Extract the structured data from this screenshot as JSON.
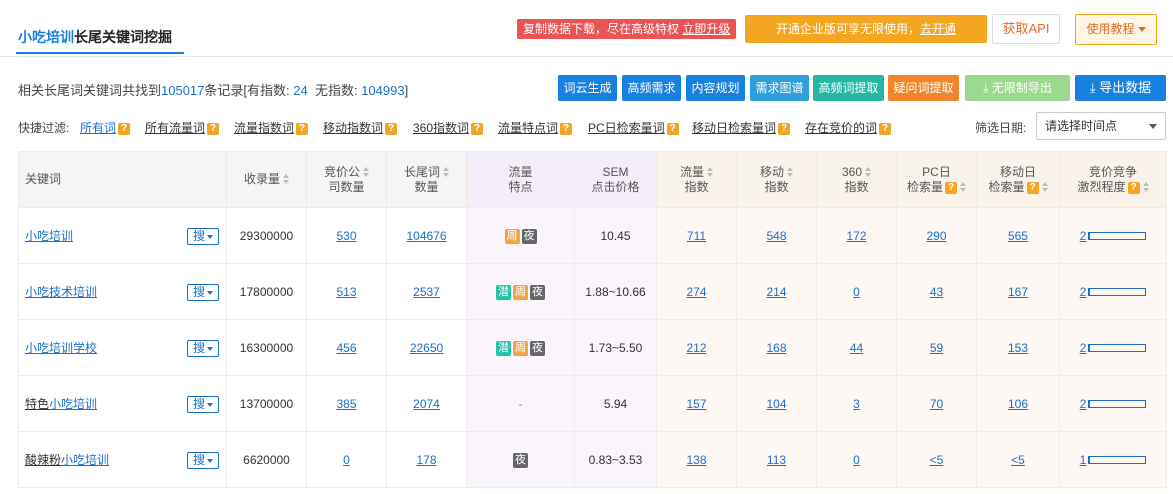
{
  "header": {
    "title_highlight": "小吃培训",
    "title_rest": "长尾关键词挖掘",
    "promo_red_text": "复制数据下载，尽在高级特权",
    "promo_red_link": "立即升级",
    "promo_orange_text": "开通企业版可享无限使用，",
    "promo_orange_link": "去开通",
    "api_button": "获取API",
    "tutorial_button": "使用教程"
  },
  "summary": {
    "prefix": "相关长尾词关键词共找到",
    "total": "105017",
    "middle": "条记录[有指数:",
    "with_index": "24",
    "no_index_label": "无指数:",
    "no_index": "104993",
    "suffix": "]"
  },
  "actions": [
    {
      "label": "词云生成",
      "color": "#1a80e0"
    },
    {
      "label": "高频需求",
      "color": "#1a80e0"
    },
    {
      "label": "内容规划",
      "color": "#1a80e0"
    },
    {
      "label": "需求图谱",
      "color": "#2e9fd8"
    },
    {
      "label": "高频词提取",
      "color": "#26b7a4"
    },
    {
      "label": "疑问词提取",
      "color": "#f0862b"
    },
    {
      "label": "无限制导出",
      "color": "#9bd98f"
    },
    {
      "label": "导出数据",
      "color": "#1a80e0"
    }
  ],
  "filters": {
    "label": "快捷过滤:",
    "items": [
      "所有词",
      "所有流量词",
      "流量指数词",
      "移动指数词",
      "360指数词",
      "流量特点词",
      "PC日检索量词",
      "移动日检索量词",
      "存在竞价的词"
    ],
    "date_label": "筛选日期:",
    "date_placeholder": "请选择时间点"
  },
  "table": {
    "headers": {
      "keyword": "关键词",
      "record": "收录量",
      "bid_companies_1": "竞价公",
      "bid_companies_2": "司数量",
      "longtail_1": "长尾词",
      "longtail_2": "数量",
      "traffic_feature_1": "流量",
      "traffic_feature_2": "特点",
      "sem_1": "SEM",
      "sem_2": "点击价格",
      "traffic_index_1": "流量",
      "traffic_index_2": "指数",
      "mobile_index_1": "移动",
      "mobile_index_2": "指数",
      "index360_1": "360",
      "index360_2": "指数",
      "pc_daily_1": "PC日",
      "pc_daily_2": "检索量",
      "mobile_daily_1": "移动日",
      "mobile_daily_2": "检索量",
      "competition_1": "竞价竞争",
      "competition_2": "激烈程度"
    },
    "search_button": "搜",
    "rows": [
      {
        "prefix": "",
        "keyword": "小吃培训",
        "record": "29300000",
        "bid": "530",
        "longtail": "104676",
        "tags": [
          "周",
          "夜"
        ],
        "sem": "10.45",
        "traffic": "711",
        "mobile": "548",
        "i360": "172",
        "pc_daily": "290",
        "mobile_daily": "565",
        "competition": "2",
        "competition_level": 0.02
      },
      {
        "prefix": "",
        "keyword": "小吃技术培训",
        "record": "17800000",
        "bid": "513",
        "longtail": "2537",
        "tags": [
          "潜",
          "周",
          "夜"
        ],
        "sem": "1.88~10.66",
        "traffic": "274",
        "mobile": "214",
        "i360": "0",
        "pc_daily": "43",
        "mobile_daily": "167",
        "competition": "2",
        "competition_level": 0.02
      },
      {
        "prefix": "",
        "keyword": "小吃培训学校",
        "record": "16300000",
        "bid": "456",
        "longtail": "22650",
        "tags": [
          "潜",
          "周",
          "夜"
        ],
        "sem": "1.73~5.50",
        "traffic": "212",
        "mobile": "168",
        "i360": "44",
        "pc_daily": "59",
        "mobile_daily": "153",
        "competition": "2",
        "competition_level": 0.02
      },
      {
        "prefix": "特色",
        "keyword": "小吃培训",
        "record": "13700000",
        "bid": "385",
        "longtail": "2074",
        "tags": [],
        "feature_text": "-",
        "sem": "5.94",
        "traffic": "157",
        "mobile": "104",
        "i360": "3",
        "pc_daily": "70",
        "mobile_daily": "106",
        "competition": "2",
        "competition_level": 0.02
      },
      {
        "prefix": "酸辣粉",
        "keyword": "小吃培训",
        "record": "6620000",
        "bid": "0",
        "longtail": "178",
        "tags": [
          "夜"
        ],
        "sem": "0.83~3.53",
        "traffic": "138",
        "mobile": "113",
        "i360": "0",
        "pc_daily": "<5",
        "mobile_daily": "<5",
        "competition": "1",
        "competition_level": 0.01
      }
    ]
  }
}
